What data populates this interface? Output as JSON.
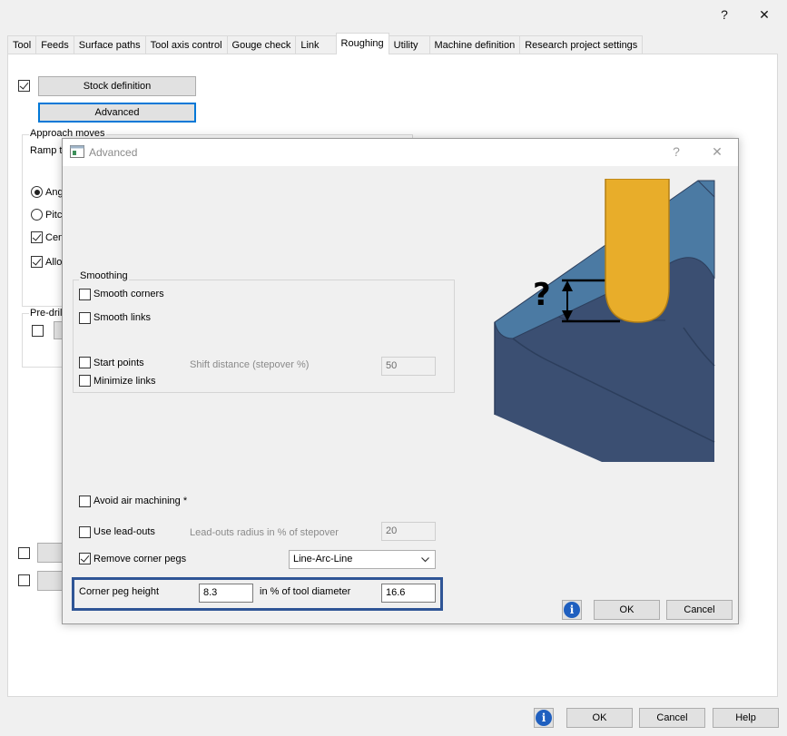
{
  "window": {
    "help_glyph": "?",
    "close_glyph": "✕"
  },
  "tabs": [
    "Tool",
    "Feeds",
    "Surface paths",
    "Tool axis control",
    "Gouge check",
    "Link",
    "Roughing",
    "Utility",
    "Machine definition",
    "Research project settings"
  ],
  "active_tab": "Roughing",
  "roughing": {
    "stock_definition_label": "Stock definition",
    "advanced_label": "Advanced",
    "approach_moves_label": "Approach moves",
    "ramp_label": "Ramp t",
    "angle_label": "Ang",
    "pitch_label": "Pitch",
    "center_label": "Cen",
    "allow_label": "Allov",
    "predrill_label": "Pre-drill"
  },
  "advanced_dialog": {
    "title": "Advanced",
    "help_glyph": "?",
    "close_glyph": "✕",
    "smoothing_label": "Smoothing",
    "smooth_corners_label": "Smooth corners",
    "smooth_links_label": "Smooth links",
    "start_points_label": "Start points",
    "shift_distance_label": "Shift distance (stepover %)",
    "shift_distance_value": "50",
    "minimize_links_label": "Minimize links",
    "avoid_air_label": "Avoid air machining *",
    "use_leadouts_label": "Use lead-outs",
    "leadouts_radius_label": "Lead-outs radius in % of stepover",
    "leadouts_radius_value": "20",
    "remove_corner_pegs_label": "Remove corner pegs",
    "corner_peg_mode": "Line-Arc-Line",
    "corner_peg_height_label": "Corner peg height",
    "corner_peg_height_value": "8.3",
    "tool_diameter_label": "in % of tool diameter",
    "tool_diameter_value": "16.6",
    "ok_label": "OK",
    "cancel_label": "Cancel",
    "illustration_glyph": "?"
  },
  "footer": {
    "ok_label": "OK",
    "cancel_label": "Cancel",
    "help_label": "Help"
  },
  "colors": {
    "accent": "#0078d7",
    "highlight_box": "#2f5596",
    "tool_orange": "#e8ad2a",
    "stock_top": "#4b7aa3",
    "stock_side": "#3b4f72"
  }
}
